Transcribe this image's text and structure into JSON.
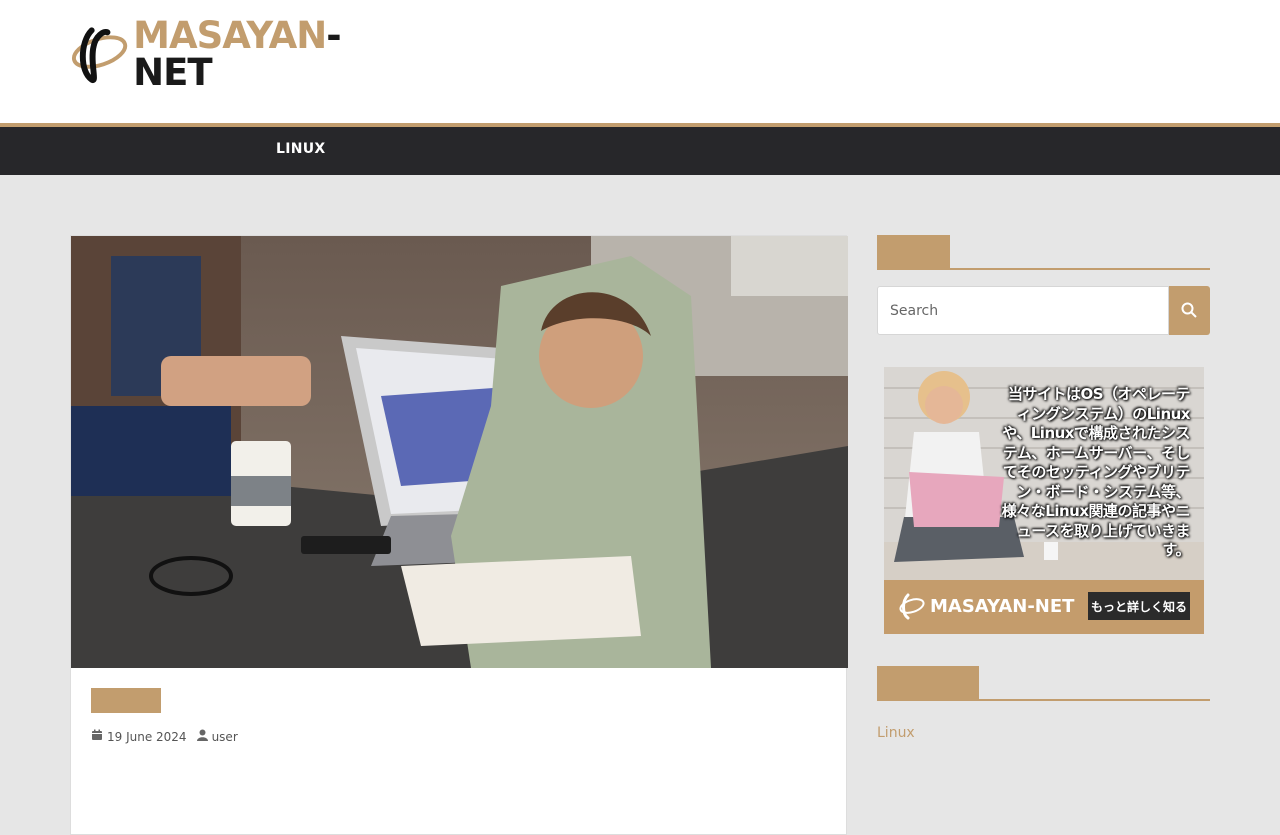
{
  "header": {
    "logo_text_primary": "MASAYAN",
    "logo_text_secondary": "-NET"
  },
  "nav": {
    "items": [
      {
        "label": "LINUX"
      }
    ]
  },
  "post": {
    "date": "19 June 2024",
    "author": "user"
  },
  "sidebar": {
    "search": {
      "placeholder": "Search"
    },
    "ad": {
      "text": "当サイトはOS（オペレーティングシステム）のLinuxや、Linuxで構成されたシステム、ホームサーバー、そしてそのセッティングやブリテン・ボード・システム等、様々なLinux関連の記事やニュースを取り上げていきます。",
      "logo_text": "MASAYAN-NET",
      "cta_label": "もっと詳しく知る"
    },
    "categories": [
      {
        "label": "Linux"
      }
    ]
  },
  "colors": {
    "accent": "#c29d6e",
    "nav_bg": "#27272a",
    "page_bg": "#e6e6e6"
  },
  "icons": [
    "logo-orbit-icon",
    "calendar-icon",
    "user-icon",
    "search-icon"
  ]
}
